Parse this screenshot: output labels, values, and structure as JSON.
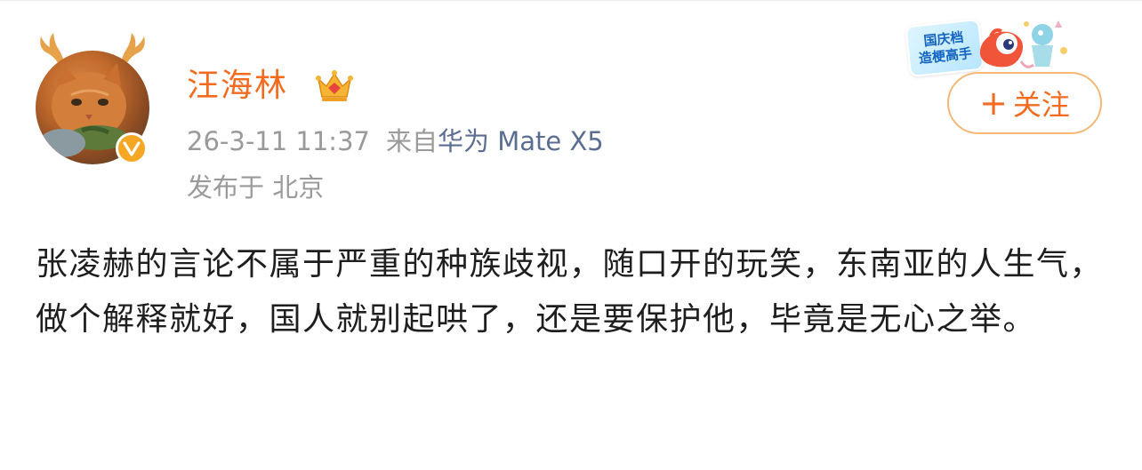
{
  "post": {
    "author": {
      "name": "汪海林",
      "verified": true,
      "badges": [
        "crown-icon"
      ],
      "avatar": "orange-cat-with-antlers"
    },
    "timestamp": "26-3-11 11:37",
    "source_prefix": "来自",
    "device": "华为 Mate X5",
    "location": "发布于 北京",
    "event_badge": {
      "line1": "国庆档",
      "line2": "造梗高手"
    },
    "follow": {
      "plus": "+",
      "label": "关注"
    },
    "content": "张凌赫的言论不属于严重的种族歧视，随口开的玩笑，东南亚的人生气，做个解释就好，国人就别起哄了，还是要保护他，毕竟是无心之举。"
  },
  "colors": {
    "name": "#f26b1f",
    "meta": "#9a9a9a",
    "device": "#5b6e92",
    "follow_border": "#f5b877",
    "text": "#1e1e1e",
    "verify": "#f5a623"
  }
}
